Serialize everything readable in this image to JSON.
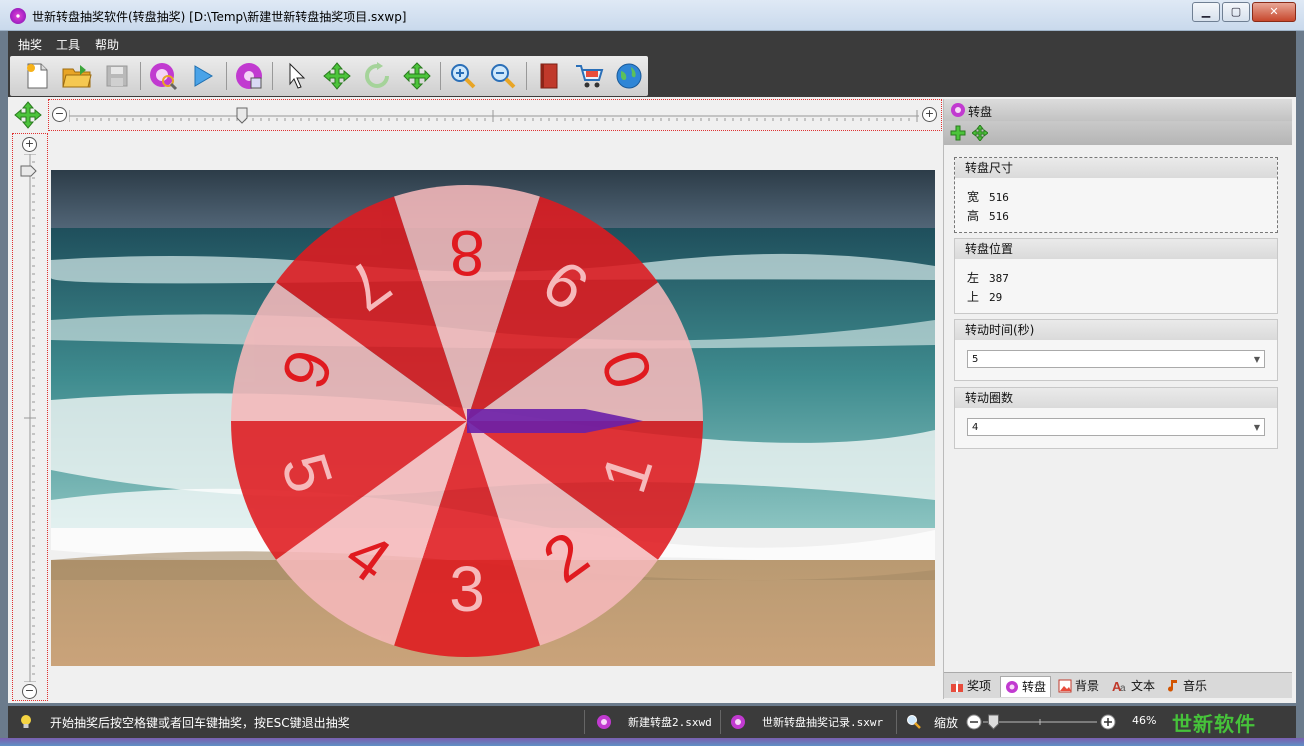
{
  "window": {
    "title": "世新转盘抽奖软件(转盘抽奖) [D:\\Temp\\新建世新转盘抽奖项目.sxwp]",
    "minimize": "▁",
    "maximize": "▢",
    "close": "✕"
  },
  "menu": [
    "抽奖",
    "工具",
    "帮助"
  ],
  "toolbar": {
    "icons": [
      "new-file-icon",
      "open-folder-icon",
      "save-disk-icon",
      "wheel-search-icon",
      "play-icon",
      "wheel-db-icon",
      "pointer-arrow-icon",
      "move-icon",
      "rotate-icon",
      "resize-icon",
      "zoom-in-icon",
      "zoom-out-icon",
      "book-icon",
      "cart-icon",
      "globe-icon"
    ]
  },
  "wheel": {
    "segments": [
      "0",
      "1",
      "2",
      "3",
      "4",
      "5",
      "6",
      "7",
      "8",
      "9"
    ],
    "colors": {
      "dark": "#e01a1f",
      "light": "#f6b9bb",
      "pointer": "#6a1fa8"
    }
  },
  "panel": {
    "header": "转盘",
    "size_group": {
      "title": "转盘尺寸",
      "width_label": "宽",
      "width": "516",
      "height_label": "高",
      "height": "516"
    },
    "position_group": {
      "title": "转盘位置",
      "left_label": "左",
      "left": "387",
      "top_label": "上",
      "top": "29"
    },
    "duration_group": {
      "title": "转动时间(秒)",
      "value": "5"
    },
    "rounds_group": {
      "title": "转动圈数",
      "value": "4"
    },
    "tabs": [
      "奖项",
      "转盘",
      "背景",
      "文本",
      "音乐"
    ],
    "active_tab": "转盘"
  },
  "status": {
    "hint": "开始抽奖后按空格键或者回车键抽奖，按ESC键退出抽奖",
    "file1": "新建转盘2.sxwd",
    "file2": "世新转盘抽奖记录.sxwr",
    "zoom_label": "缩放",
    "zoom_value": "46%",
    "zoom_fraction": 0.46,
    "brand": "世新软件"
  }
}
